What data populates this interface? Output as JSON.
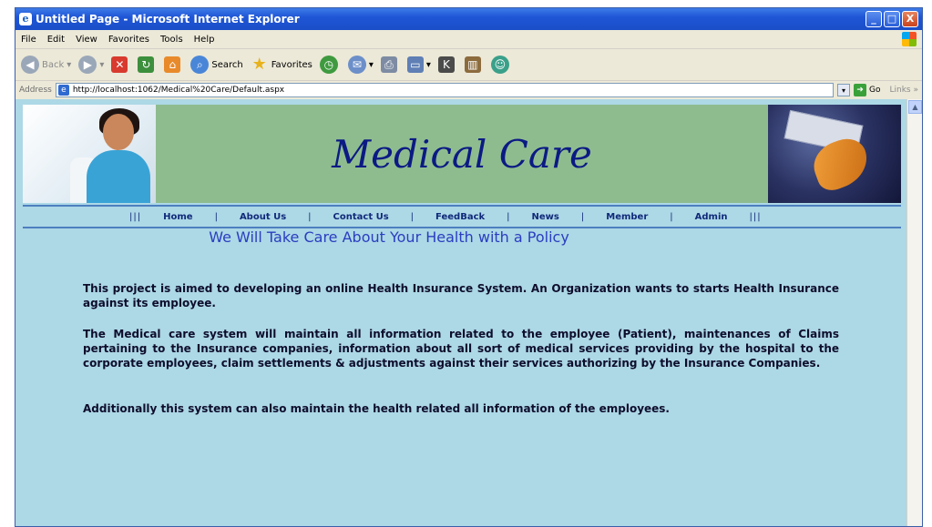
{
  "window": {
    "title": "Untitled Page - Microsoft Internet Explorer",
    "controls": {
      "minimize": "_",
      "maximize": "□",
      "close": "X"
    }
  },
  "menu": {
    "items": [
      "File",
      "Edit",
      "View",
      "Favorites",
      "Tools",
      "Help"
    ]
  },
  "toolbar": {
    "back_label": "Back",
    "search_label": "Search",
    "favorites_label": "Favorites"
  },
  "address": {
    "label": "Address",
    "url": "http://localhost:1062/Medical%20Care/Default.aspx",
    "go_label": "Go",
    "links_label": "Links"
  },
  "page": {
    "brand": "Medical Care",
    "nav": [
      "Home",
      "About Us",
      "Contact Us",
      "FeedBack",
      "News",
      "Member",
      "Admin"
    ],
    "nav_edge": "|||",
    "nav_sep": "|",
    "headline": "We Will Take Care About Your Health with a Policy",
    "paragraphs": [
      "This project is aimed to developing an online Health Insurance System. An Organization wants to starts Health Insurance against its employee.",
      "The Medical care system will maintain all information related to the employee (Patient), maintenances of Claims pertaining to the Insurance companies, information about all sort of medical services providing by the hospital to the corporate employees, claim settlements & adjustments against their services authorizing by the Insurance Companies.",
      "Additionally this system can also maintain the health related all information of the employees."
    ]
  },
  "colors": {
    "page_bg": "#add8e6",
    "banner_bg": "#8fbc8f",
    "brand_text": "#0b1a84",
    "nav_text": "#102a7a",
    "headline_text": "#2a3ec0"
  }
}
